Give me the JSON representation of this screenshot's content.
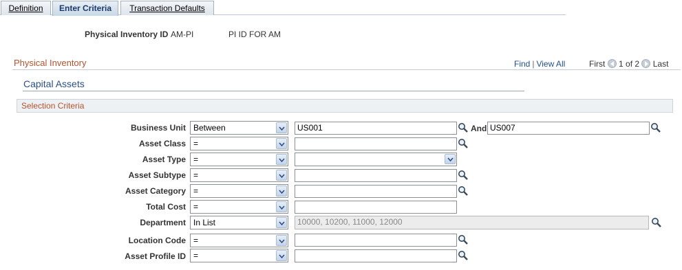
{
  "tabs": [
    {
      "label": "Definition",
      "active": false
    },
    {
      "label": "Enter Criteria",
      "active": true
    },
    {
      "label": "Transaction Defaults",
      "active": false
    }
  ],
  "header": {
    "pi_id_label": "Physical Inventory ID",
    "pi_id_value": "AM-PI",
    "pi_description": "PI ID FOR AM"
  },
  "scroll": {
    "title": "Physical Inventory",
    "find": "Find",
    "view_all": "View All",
    "first": "First",
    "position": "1 of 2",
    "last": "Last"
  },
  "section_title": "Capital Assets",
  "selection_title": "Selection Criteria",
  "between_and_label": "And",
  "fields": [
    {
      "label": "Business Unit",
      "operator": "Between",
      "value": "US001",
      "value2": "US007"
    },
    {
      "label": "Asset Class",
      "operator": "=",
      "value": ""
    },
    {
      "label": "Asset Type",
      "operator": "=",
      "value": ""
    },
    {
      "label": "Asset Subtype",
      "operator": "=",
      "value": ""
    },
    {
      "label": "Asset Category",
      "operator": "=",
      "value": ""
    },
    {
      "label": "Total Cost",
      "operator": "=",
      "value": ""
    },
    {
      "label": "Department",
      "operator": "In List",
      "value": "10000, 10200, 11000, 12000"
    },
    {
      "label": "Location Code",
      "operator": "=",
      "value": ""
    },
    {
      "label": "Asset Profile ID",
      "operator": "=",
      "value": ""
    }
  ],
  "colors": {
    "accent_title": "#b5522d",
    "link": "#1f4f8a",
    "section": "#2b4f84"
  }
}
